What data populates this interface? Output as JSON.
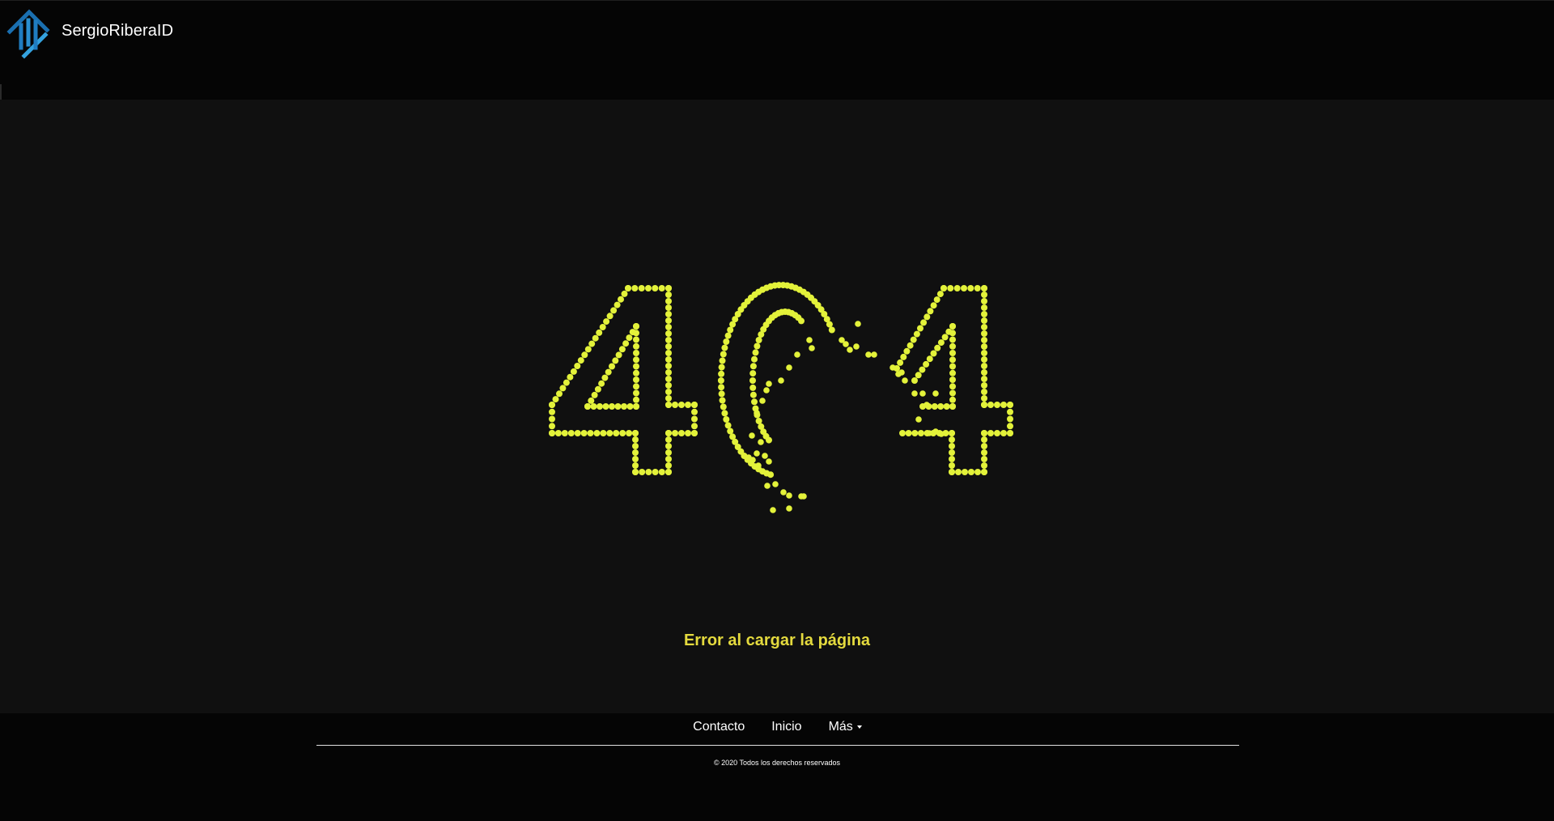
{
  "header": {
    "brand_name": "SergioRiberaID",
    "logo_icon": "sri-logo-icon",
    "logo_colors": [
      "#1a6fb0",
      "#34a2de"
    ]
  },
  "main": {
    "big_number": "404",
    "error_message": "Error al cargar la página",
    "particle_color": "#e3f23a",
    "message_color": "#e4da3e"
  },
  "footer": {
    "nav": [
      {
        "label": "Contacto"
      },
      {
        "label": "Inicio"
      },
      {
        "label": "Más",
        "dropdown": true
      }
    ],
    "copyright": "© 2020 Todos los derechos reservados"
  }
}
